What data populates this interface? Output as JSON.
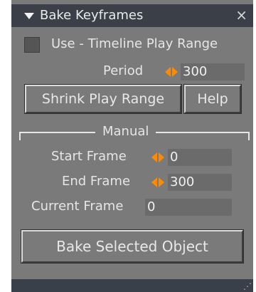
{
  "window": {
    "title": "Bake Keyframes",
    "close_glyph": "×",
    "collapse_icon": "triangle-down-icon"
  },
  "use_timeline": {
    "label": "Use - Timeline Play Range",
    "checked": false
  },
  "period": {
    "label": "Period",
    "value": "300"
  },
  "buttons": {
    "shrink": "Shrink Play Range",
    "help": "Help",
    "bake": "Bake Selected Object"
  },
  "manual_group": {
    "label": "Manual",
    "start_frame": {
      "label": "Start Frame",
      "value": "0"
    },
    "end_frame": {
      "label": "End Frame",
      "value": "300"
    },
    "current_frame": {
      "label": "Current Frame",
      "value": "0"
    }
  },
  "colors": {
    "panel_bg": "#7a7a7a",
    "titlebar_bg": "#3a3f48",
    "spinner_accent": "#ff8a00"
  }
}
